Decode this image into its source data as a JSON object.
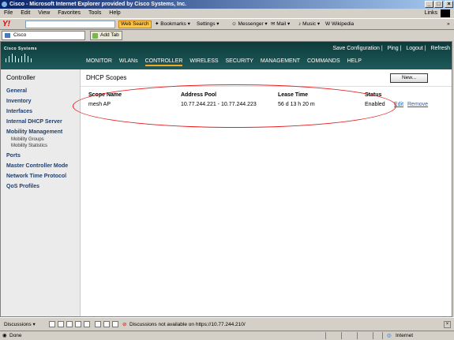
{
  "window": {
    "title": "Cisco - Microsoft Internet Explorer provided by Cisco Systems, Inc."
  },
  "menubar": {
    "items": [
      "File",
      "Edit",
      "View",
      "Favorites",
      "Tools",
      "Help"
    ],
    "links": "Links"
  },
  "toolbar": {
    "search_button": "Web Search",
    "bookmarks": "Bookmarks",
    "settings": "Settings",
    "messenger": "Messenger",
    "mail": "Mail",
    "music": "Music",
    "wikipedia": "Wikipedia"
  },
  "tabs": {
    "active": "Cisco",
    "add": "Add Tab"
  },
  "header": {
    "logo": "Cisco Systems",
    "links": [
      "Save Configuration",
      "Ping",
      "Logout",
      "Refresh"
    ],
    "nav": [
      "MONITOR",
      "WLANs",
      "CONTROLLER",
      "WIRELESS",
      "SECURITY",
      "MANAGEMENT",
      "COMMANDS",
      "HELP"
    ],
    "active_nav": "CONTROLLER"
  },
  "sidebar": {
    "title": "Controller",
    "items": [
      "General",
      "Inventory",
      "Interfaces",
      "Internal DHCP Server",
      "Mobility Management",
      "Ports",
      "Master Controller Mode",
      "Network Time Protocol",
      "QoS Profiles"
    ],
    "subitems": [
      "Mobility Groups",
      "Mobility Statistics"
    ]
  },
  "main": {
    "title": "DHCP Scopes",
    "new_button": "New...",
    "columns": [
      "Scope Name",
      "Address Pool",
      "Lease Time",
      "Status"
    ],
    "rows": [
      {
        "scope_name": "mesh AP",
        "address_pool": "10.77.244.221 - 10.77.244.223",
        "lease_time": "56 d 13 h 20 m",
        "status": "Enabled",
        "edit": "Edit",
        "remove": "Remove"
      }
    ]
  },
  "discussions": {
    "label": "Discussions",
    "message": "Discussions not available on https://10.77.244.210/"
  },
  "statusbar": {
    "status": "Done",
    "zone": "Internet"
  },
  "colors": {
    "header_bg": "#1e5a5a",
    "active_tab_underline": "#f5a623",
    "annotation_ellipse": "#e42020",
    "link": "#2a5fa8"
  }
}
